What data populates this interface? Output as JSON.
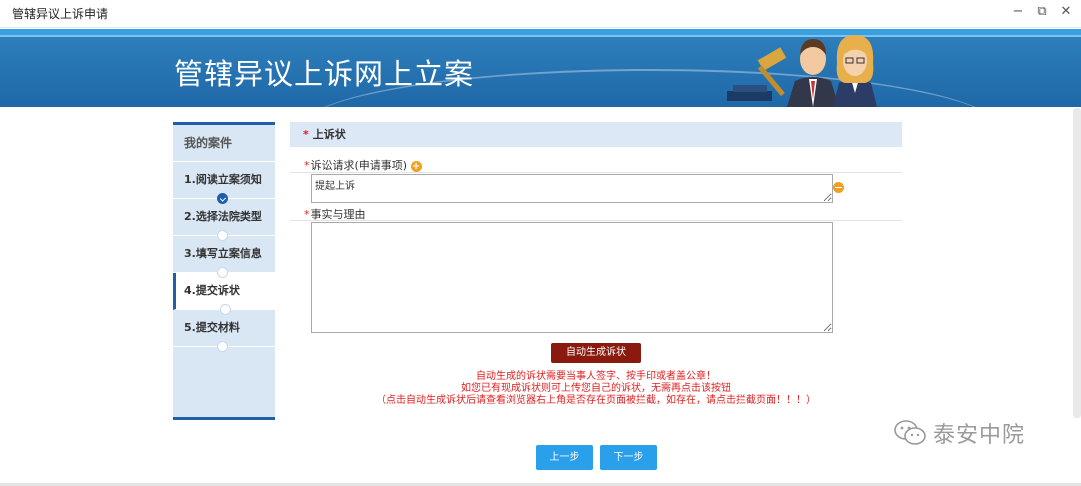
{
  "window": {
    "title": "管辖异议上诉申请",
    "controls": [
      "−",
      "⧉",
      "✕"
    ]
  },
  "banner": {
    "title": "管辖异议上诉网上立案"
  },
  "sidebar": {
    "header": "我的案件",
    "items": [
      {
        "label": "1.阅读立案须知",
        "state": "done"
      },
      {
        "label": "2.选择法院类型",
        "state": "pending"
      },
      {
        "label": "3.填写立案信息",
        "state": "pending"
      },
      {
        "label": "4.提交诉状",
        "state": "active"
      },
      {
        "label": "5.提交材料",
        "state": "pending"
      }
    ]
  },
  "form": {
    "section_title": "上诉状",
    "required_mark": "*",
    "claim_label": "诉讼请求(申请事项)",
    "claim_value": "提起上诉",
    "facts_label": "事实与理由",
    "facts_value": "",
    "generate_button": "自动生成诉状"
  },
  "notice": {
    "line1": "自动生成的诉状需要当事人签字、按手印或者盖公章！",
    "line2": "如您已有现成诉状则可上传您自己的诉状，无需再点击该按钮",
    "line3": "（点击自动生成诉状后请查看浏览器右上角是否存在页面被拦截，如存在，请点击拦截页面！！！）"
  },
  "nav": {
    "prev": "上一步",
    "next": "下一步"
  },
  "watermark": {
    "text": "泰安中院"
  },
  "colors": {
    "brand": "#1e5fa8",
    "button_red": "#8b1a0e",
    "button_blue": "#2a9fea",
    "notice": "#e02020"
  }
}
